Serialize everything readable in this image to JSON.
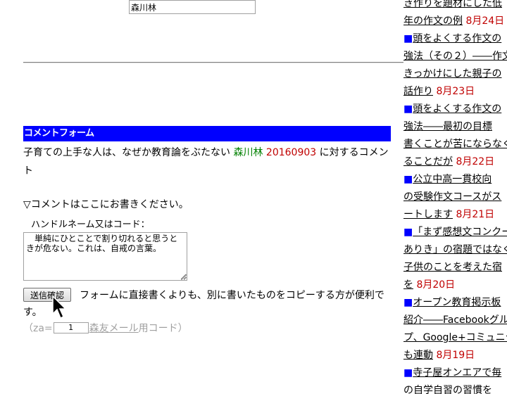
{
  "form": {
    "header": "コメントフォーム",
    "target_title": "子育ての上手な人は、なぜか教育論をぶたない",
    "target_author": "森川林",
    "target_date": "20160903",
    "target_suffix": "に対するコメント",
    "prompt": "▽コメントはここにお書きください。",
    "name_label": "ハンドルネーム又はコード：",
    "name_value": "森川林",
    "comment_value": "　単純にひとことで割り切れると思うときが危ない。これは、自戒の言葉。",
    "submit_label": "送信確認",
    "note": "フォームに直接書くよりも、別に書いたものをコピーする方が便利です。",
    "za_prefix": "（za=",
    "za_value": "1",
    "za_link": "森友メール",
    "za_suffix": "用コード）"
  },
  "sidebar": {
    "lines": [
      {
        "text": "き作りを題材にした低",
        "date": "",
        "square": false
      },
      {
        "text": "年の作文の例",
        "date": "8月24日",
        "square": false
      },
      {
        "text": "頭をよくする作文の",
        "date": "",
        "square": true
      },
      {
        "text": "強法（その２）――作文",
        "date": "",
        "square": false
      },
      {
        "text": "きっかけにした親子の",
        "date": "",
        "square": false
      },
      {
        "text": "話作り",
        "date": "8月23日",
        "square": false
      },
      {
        "text": "頭をよくする作文の",
        "date": "",
        "square": true
      },
      {
        "text": "強法――最初の目標",
        "date": "",
        "square": false
      },
      {
        "text": "書くことが苦にならなく",
        "date": "",
        "square": false
      },
      {
        "text": "ることだが",
        "date": "8月22日",
        "square": false
      },
      {
        "text": "公立中高一貫校向",
        "date": "",
        "square": true
      },
      {
        "text": "の受験作文コースがス",
        "date": "",
        "square": false
      },
      {
        "text": "ートします",
        "date": "8月21日",
        "square": false
      },
      {
        "text": "「まず感想文コンクー",
        "date": "",
        "square": true
      },
      {
        "text": "ありき」の宿題ではなく",
        "date": "",
        "square": false
      },
      {
        "text": "子供のことを考えた宿",
        "date": "",
        "square": false
      },
      {
        "text": "を",
        "date": "8月20日",
        "square": false
      },
      {
        "text": "オープン教育掲示板",
        "date": "",
        "square": true
      },
      {
        "text": "紹介――Facebookグル",
        "date": "",
        "square": false
      },
      {
        "text": "プ、Google+コミュニティ",
        "date": "",
        "square": false
      },
      {
        "text": "も連動",
        "date": "8月19日",
        "square": false
      },
      {
        "text": "寺子屋オンエアで毎",
        "date": "",
        "square": true
      },
      {
        "text": "の自学自習の習慣を",
        "date": "",
        "square": false
      }
    ]
  }
}
